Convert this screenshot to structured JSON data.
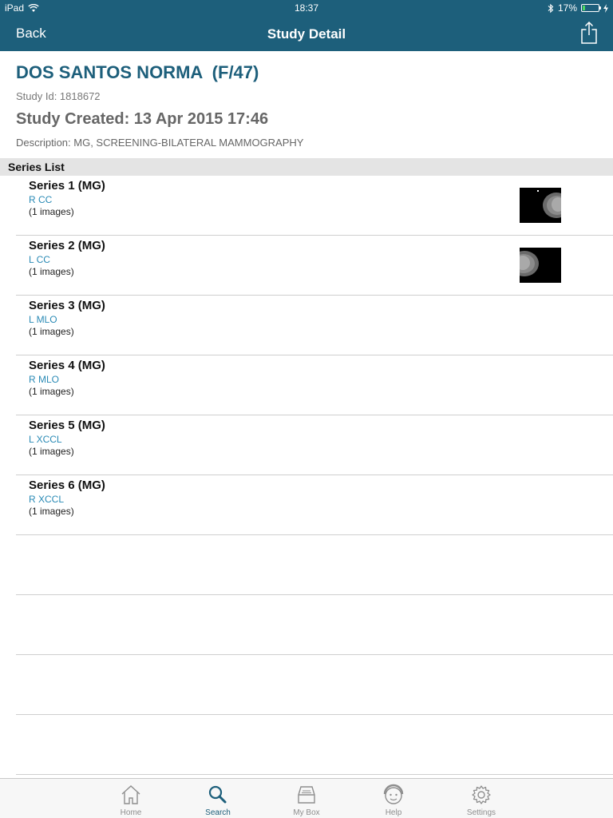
{
  "status_bar": {
    "carrier": "iPad",
    "time": "18:37",
    "battery_percent": "17%",
    "battery_level": 0.17
  },
  "nav": {
    "back_label": "Back",
    "title": "Study Detail",
    "share_icon": "share-icon"
  },
  "patient": {
    "name": "DOS SANTOS NORMA  (F/47)",
    "study_id": "Study Id: 1818672",
    "study_created": "Study Created: 13 Apr 2015 17:46",
    "description": "Description: MG, SCREENING-BILATERAL MAMMOGRAPHY"
  },
  "series_list": {
    "header": "Series List",
    "items": [
      {
        "title": "Series 1 (MG)",
        "view": "R CC",
        "count": "(1 images)",
        "has_thumbnail": true
      },
      {
        "title": "Series 2 (MG)",
        "view": "L CC",
        "count": "(1 images)",
        "has_thumbnail": true
      },
      {
        "title": "Series 3 (MG)",
        "view": "L MLO",
        "count": "(1 images)",
        "has_thumbnail": false
      },
      {
        "title": "Series 4 (MG)",
        "view": "R MLO",
        "count": "(1 images)",
        "has_thumbnail": false
      },
      {
        "title": "Series 5 (MG)",
        "view": "L XCCL",
        "count": "(1 images)",
        "has_thumbnail": false
      },
      {
        "title": "Series 6 (MG)",
        "view": "R XCCL",
        "count": "(1 images)",
        "has_thumbnail": false
      }
    ]
  },
  "tabbar": {
    "tabs": [
      {
        "label": "Home",
        "icon": "home-icon"
      },
      {
        "label": "Search",
        "icon": "search-icon",
        "active": true
      },
      {
        "label": "My Box",
        "icon": "inbox-icon"
      },
      {
        "label": "Help",
        "icon": "help-face-icon"
      },
      {
        "label": "Settings",
        "icon": "gear-icon"
      }
    ]
  },
  "colors": {
    "nav_background": "#1d5f7b",
    "accent": "#1d5f7b",
    "link": "#2a8ab5"
  }
}
